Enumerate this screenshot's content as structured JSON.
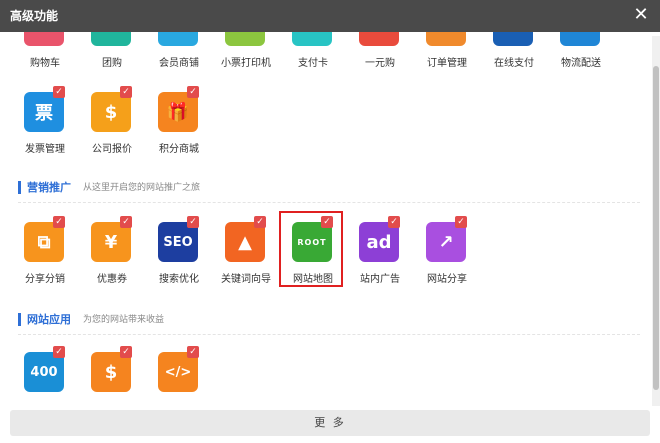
{
  "dialog": {
    "title": "高级功能",
    "close_glyph": "✕"
  },
  "top_row": [
    {
      "label": "购物车",
      "color": "#e9546b",
      "icon": "cart-icon"
    },
    {
      "label": "团购",
      "color": "#20b59c",
      "icon": "group-buy-icon"
    },
    {
      "label": "会员商铺",
      "color": "#29a8e0",
      "icon": "member-shop-icon"
    },
    {
      "label": "小票打印机",
      "color": "#8cc63f",
      "icon": "receipt-printer-icon"
    },
    {
      "label": "支付卡",
      "color": "#28c4c4",
      "icon": "pay-card-icon"
    },
    {
      "label": "一元购",
      "color": "#e94b3c",
      "icon": "one-yuan-icon"
    },
    {
      "label": "订单管理",
      "color": "#f08a2c",
      "icon": "order-icon"
    },
    {
      "label": "在线支付",
      "color": "#1a5fb4",
      "icon": "online-pay-icon"
    },
    {
      "label": "物流配送",
      "color": "#1f86d6",
      "icon": "logistics-icon"
    }
  ],
  "row2": [
    {
      "label": "发票管理",
      "color": "#1f8fe0",
      "icon": "invoice-icon",
      "glyph": "票"
    },
    {
      "label": "公司报价",
      "color": "#f5a01a",
      "icon": "quote-sign-icon",
      "glyph": "$"
    },
    {
      "label": "积分商城",
      "color": "#f5841f",
      "icon": "gift-icon",
      "glyph": "🎁"
    }
  ],
  "marketing": {
    "title": "营销推广",
    "subtitle": "从这里开启您的网站推广之旅",
    "items": [
      {
        "label": "分享分销",
        "color": "#f7941d",
        "icon": "share-distribute-icon",
        "glyph": "⧉"
      },
      {
        "label": "优惠券",
        "color": "#f7941d",
        "icon": "coupon-icon",
        "glyph": "¥"
      },
      {
        "label": "搜索优化",
        "color": "#1d3ea0",
        "icon": "seo-icon",
        "glyph": "SEO"
      },
      {
        "label": "关键词向导",
        "color": "#f26522",
        "icon": "keyword-guide-icon",
        "glyph": "▲"
      },
      {
        "label": "网站地图",
        "color": "#39a935",
        "icon": "sitemap-icon",
        "glyph": "ROOT"
      },
      {
        "label": "站内广告",
        "color": "#8d3fd6",
        "icon": "ad-icon",
        "glyph": "ad"
      },
      {
        "label": "网站分享",
        "color": "#a94fe0",
        "icon": "site-share-icon",
        "glyph": "↗"
      }
    ]
  },
  "site_apps": {
    "title": "网站应用",
    "subtitle": "为您的网站带来收益",
    "items": [
      {
        "label": "",
        "color": "#1a8fd6",
        "icon": "hotline-400-icon",
        "glyph": "400"
      },
      {
        "label": "",
        "color": "#f5841f",
        "icon": "money-bag-icon",
        "glyph": "$"
      },
      {
        "label": "",
        "color": "#f5841f",
        "icon": "code-settings-icon",
        "glyph": "</>"
      }
    ]
  },
  "footer": {
    "more_label": "更 多"
  },
  "check_glyph": "✓"
}
